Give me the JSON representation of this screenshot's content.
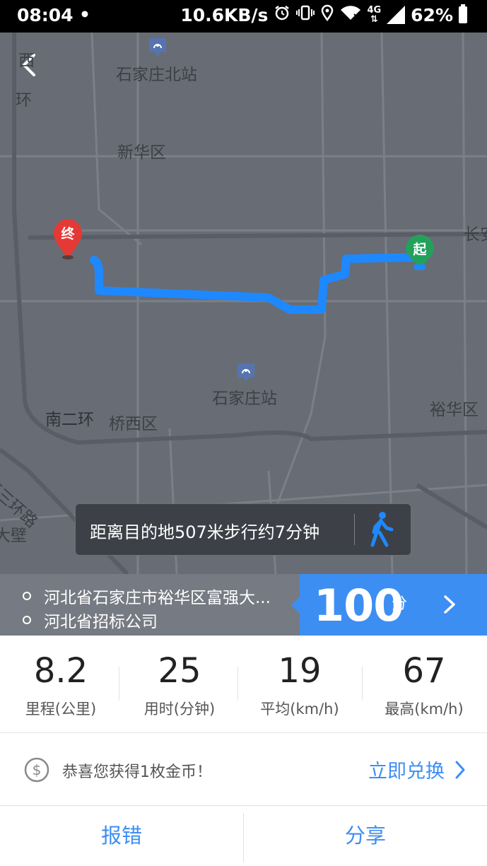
{
  "status_bar": {
    "time": "08:04",
    "dot": "•",
    "network_speed": "10.6KB/s",
    "network_type": "4G",
    "battery": "62%",
    "icons": [
      "alarm-icon",
      "vibrate-icon",
      "location-icon",
      "wifi-icon",
      "signal-icon",
      "battery-icon"
    ]
  },
  "map": {
    "labels": {
      "north_station": "石家庄北站",
      "xinhua": "新华区",
      "ring_west_1": "西",
      "ring_west_2": "环",
      "changan": "长安",
      "station": "石家庄站",
      "south_ring": "南二环",
      "qiaoxi": "桥西区",
      "yuhua": "裕华区",
      "west_third_ring": "西三环路",
      "bi": "大壁"
    },
    "end_marker": "终",
    "start_marker": "起",
    "colors": {
      "route": "#1e88ff",
      "start": "#23a15c",
      "end": "#e53935",
      "background": "#686c74"
    }
  },
  "info_pill": {
    "text": "距离目的地507米步行约7分钟",
    "icon": "walking-person-icon"
  },
  "addresses": {
    "from": "河北省石家庄市裕华区富强大...",
    "to": "河北省招标公司"
  },
  "score": {
    "value": "100",
    "unit": "分"
  },
  "stats": [
    {
      "value": "8.2",
      "label": "里程(公里)"
    },
    {
      "value": "25",
      "label": "用时(分钟)"
    },
    {
      "value": "19",
      "label": "平均(km/h)"
    },
    {
      "value": "67",
      "label": "最高(km/h)"
    }
  ],
  "coin": {
    "text": "恭喜您获得1枚金币！",
    "link": "立即兑换",
    "icon": "dollar-coin-icon"
  },
  "bottom": {
    "report": "报错",
    "share": "分享"
  },
  "accent_color": "#3d8ef2"
}
